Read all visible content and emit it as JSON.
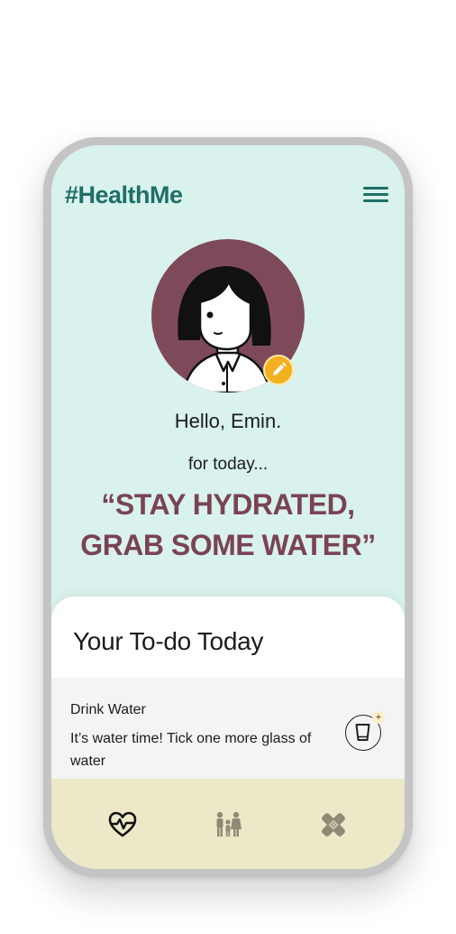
{
  "app": {
    "logo": "#HealthMe"
  },
  "header": {
    "menu_icon": "hamburger-menu-icon"
  },
  "profile": {
    "avatar_icon": "user-avatar",
    "edit_icon": "pencil-icon",
    "greeting": "Hello, Emin."
  },
  "daily": {
    "subtitle": "for today...",
    "quote_line1": "“STAY HYDRATED,",
    "quote_line2": "GRAB SOME WATER”"
  },
  "todo": {
    "title": "Your To-do Today",
    "items": [
      {
        "name": "Drink Water",
        "description": "It’s water time! Tick one more glass of water",
        "action_icon": "glass-icon",
        "badge": "+"
      }
    ]
  },
  "nav": {
    "items": [
      {
        "icon": "heart-pulse-icon",
        "active": true
      },
      {
        "icon": "family-icon",
        "active": false
      },
      {
        "icon": "bandage-icon",
        "active": false
      }
    ]
  },
  "colors": {
    "background": "#d9f2ed",
    "brand": "#1f6f66",
    "accent": "#7a4355",
    "avatar_bg": "#7e4a5a",
    "edit": "#f3b020",
    "nav_bg": "#ece8c8"
  }
}
